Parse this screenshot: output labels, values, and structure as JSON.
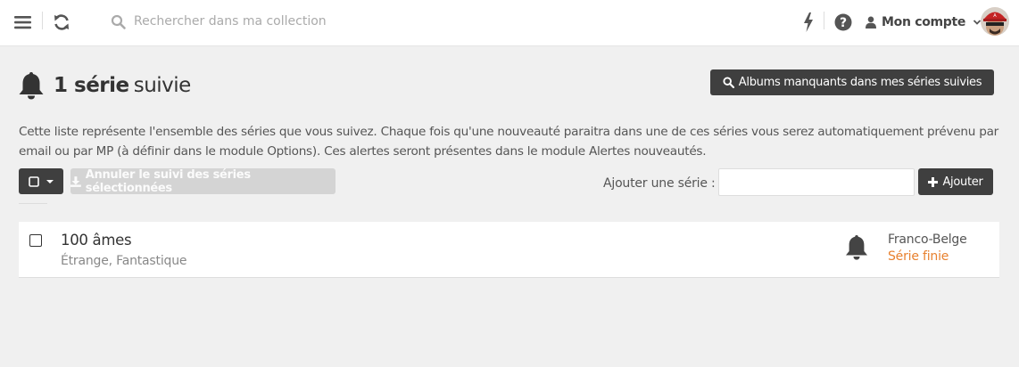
{
  "topbar": {
    "search_placeholder": "Rechercher dans ma collection",
    "account_label": "Mon compte"
  },
  "header": {
    "count": "1 série",
    "word": "suivie",
    "missing_button": "Albums manquants dans mes séries suivies"
  },
  "description": "Cette liste représente l'ensemble des séries que vous suivez. Chaque fois qu'une nouveauté paraitra dans une de ces séries vous serez automatiquement prévenu par email ou par MP (à définir dans le module Options). Ces alertes seront présentes dans le module Alertes nouveautés.",
  "toolbar": {
    "cancel_follow": "Annuler le suivi des séries sélectionnées",
    "add_label": "Ajouter une série :",
    "add_input_value": "",
    "add_button": "Ajouter"
  },
  "series": [
    {
      "title": "100 âmes",
      "genres": "Étrange, Fantastique",
      "origin": "Franco-Belge",
      "status": "Série finie"
    }
  ],
  "colors": {
    "dark_button": "#3f3f3f",
    "status_orange": "#e8812f",
    "page_bg": "#f0f0f0"
  },
  "icons": [
    "menu-icon",
    "refresh-icon",
    "search-icon",
    "bolt-icon",
    "question-icon",
    "user-icon",
    "chevron-down-icon",
    "bell-icon",
    "square-icon",
    "caret-down-icon",
    "download-icon",
    "plus-icon"
  ]
}
